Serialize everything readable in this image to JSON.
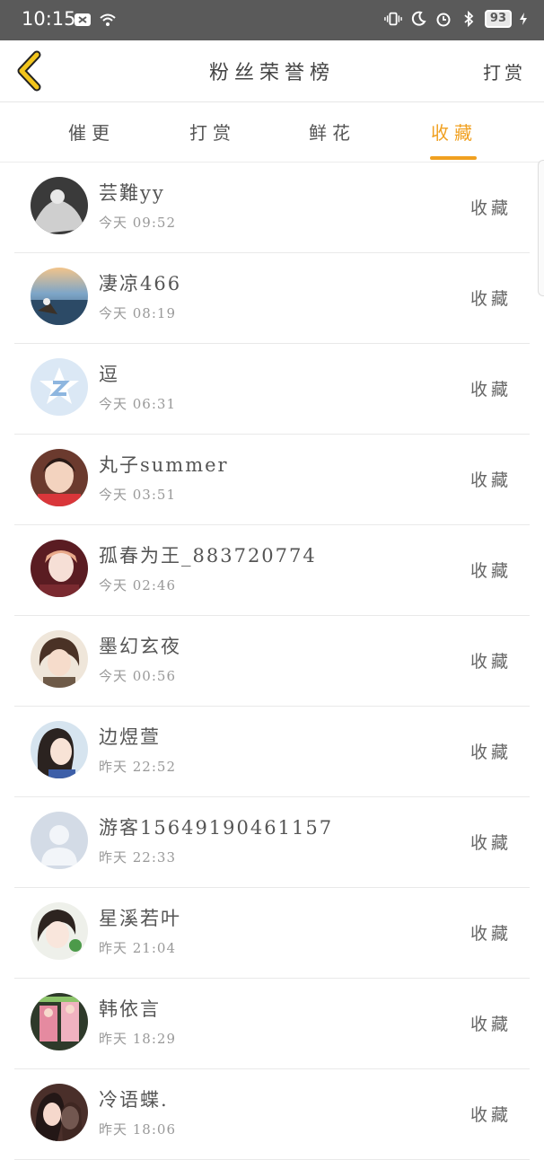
{
  "status_bar": {
    "time": "10:15",
    "battery": "93",
    "icons": [
      "message-icon",
      "wifi-icon",
      "vibrate-icon",
      "moon-icon",
      "alarm-icon",
      "bluetooth-icon",
      "battery-icon",
      "charging-icon"
    ]
  },
  "header": {
    "title": "粉丝荣誉榜",
    "action": "打赏",
    "back_icon": "chevron-left-icon"
  },
  "tabs": [
    {
      "label": "催更",
      "active": false
    },
    {
      "label": "打赏",
      "active": false
    },
    {
      "label": "鲜花",
      "active": false
    },
    {
      "label": "收藏",
      "active": true
    }
  ],
  "colors": {
    "accent": "#f0a020",
    "status_bar": "#5a5a5a",
    "back_chevron": "#f2c51c"
  },
  "list": [
    {
      "name": "芸難yy",
      "time": "今天 09:52",
      "action": "收藏"
    },
    {
      "name": "凄凉466",
      "time": "今天 08:19",
      "action": "收藏"
    },
    {
      "name": "逗",
      "time": "今天 06:31",
      "action": "收藏"
    },
    {
      "name": "丸子summer",
      "time": "今天 03:51",
      "action": "收藏"
    },
    {
      "name": "孤春为王_883720774",
      "time": "今天 02:46",
      "action": "收藏"
    },
    {
      "name": "墨幻玄夜",
      "time": "今天 00:56",
      "action": "收藏"
    },
    {
      "name": "边煜萱",
      "time": "昨天 22:52",
      "action": "收藏"
    },
    {
      "name": "游客15649190461157",
      "time": "昨天 22:33",
      "action": "收藏"
    },
    {
      "name": "星溪若叶",
      "time": "昨天 21:04",
      "action": "收藏"
    },
    {
      "name": "韩依言",
      "time": "昨天 18:29",
      "action": "收藏"
    },
    {
      "name": "冷语蝶.",
      "time": "昨天 18:06",
      "action": "收藏"
    }
  ]
}
